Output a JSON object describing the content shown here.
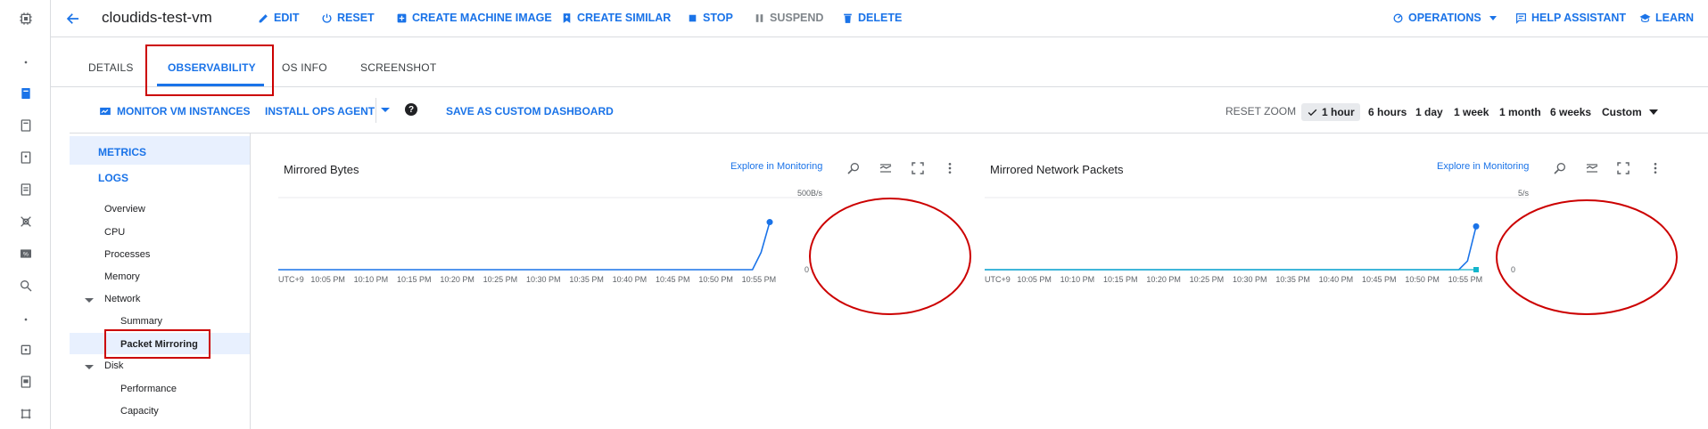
{
  "header": {
    "vm_name": "cloudids-test-vm",
    "actions": [
      {
        "label": "EDIT",
        "icon": "pencil-icon"
      },
      {
        "label": "RESET",
        "icon": "reset-icon"
      },
      {
        "label": "CREATE MACHINE IMAGE",
        "icon": "add-box-icon"
      },
      {
        "label": "CREATE SIMILAR",
        "icon": "bookmark-add-icon"
      },
      {
        "label": "STOP",
        "icon": "stop-icon"
      },
      {
        "label": "SUSPEND",
        "icon": "pause-icon"
      },
      {
        "label": "DELETE",
        "icon": "trash-icon"
      }
    ],
    "right_actions": [
      {
        "label": "OPERATIONS",
        "icon": "operations-icon"
      },
      {
        "label": "HELP ASSISTANT",
        "icon": "chat-icon"
      },
      {
        "label": "LEARN",
        "icon": "school-icon"
      }
    ]
  },
  "tabs": [
    "DETAILS",
    "OBSERVABILITY",
    "OS INFO",
    "SCREENSHOT"
  ],
  "active_tab": "OBSERVABILITY",
  "toolbar": {
    "monitor": "MONITOR VM INSTANCES",
    "install": "INSTALL OPS AGENT",
    "save": "SAVE AS CUSTOM DASHBOARD",
    "reset_zoom": "RESET ZOOM",
    "ranges": [
      "1 hour",
      "6 hours",
      "1 day",
      "1 week",
      "1 month",
      "6 weeks"
    ],
    "selected_range": "1 hour",
    "custom": "Custom"
  },
  "nav": {
    "metrics": "METRICS",
    "logs": "LOGS",
    "items": [
      "Overview",
      "CPU",
      "Processes",
      "Memory"
    ],
    "network": "Network",
    "network_items": [
      "Summary",
      "Packet Mirroring"
    ],
    "disk": "Disk",
    "disk_items": [
      "Performance",
      "Capacity"
    ]
  },
  "accent": "#1a73e8",
  "annotation_color": "#cc0000",
  "chart_data": [
    {
      "type": "line",
      "title": "Mirrored Bytes",
      "explore": "Explore in Monitoring",
      "y_max_label": "500B/s",
      "y_zero_label": "0",
      "ylim": [
        0,
        500
      ],
      "x_labels": [
        "UTC+9",
        "10:05 PM",
        "10:10 PM",
        "10:15 PM",
        "10:20 PM",
        "10:25 PM",
        "10:30 PM",
        "10:35 PM",
        "10:40 PM",
        "10:45 PM",
        "10:50 PM",
        "10:55 PM"
      ],
      "series": [
        {
          "color": "#1a73e8",
          "x_minutes": [
            0,
            55,
            56,
            57
          ],
          "values": [
            0,
            0,
            120,
            330
          ]
        }
      ]
    },
    {
      "type": "line",
      "title": "Mirrored Network Packets",
      "explore": "Explore in Monitoring",
      "y_max_label": "5/s",
      "y_zero_label": "0",
      "ylim": [
        0,
        5
      ],
      "x_labels": [
        "UTC+9",
        "10:05 PM",
        "10:10 PM",
        "10:15 PM",
        "10:20 PM",
        "10:25 PM",
        "10:30 PM",
        "10:35 PM",
        "10:40 PM",
        "10:45 PM",
        "10:50 PM",
        "10:55 PM"
      ],
      "series": [
        {
          "color": "#1a73e8",
          "x_minutes": [
            0,
            55,
            56,
            57
          ],
          "values": [
            0,
            0,
            0.6,
            3.0
          ]
        },
        {
          "color": "#12b5cb",
          "x_minutes": [
            0,
            57
          ],
          "values": [
            0,
            0
          ]
        }
      ]
    }
  ]
}
